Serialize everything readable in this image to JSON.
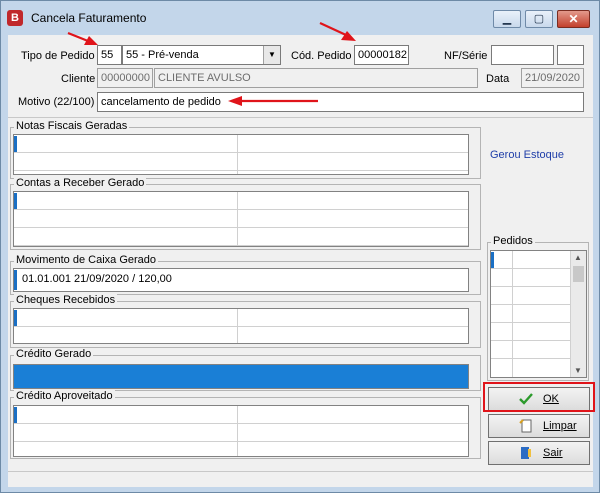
{
  "window": {
    "title": "Cancela Faturamento"
  },
  "header": {
    "tipo_pedido_label": "Tipo de Pedido",
    "tipo_pedido_code": "55",
    "tipo_pedido_value": "55 - Pré-venda",
    "cod_pedido_label": "Cód. Pedido",
    "cod_pedido_value": "00000182",
    "nf_serie_label": "NF/Série",
    "nf_value": "",
    "serie_value": "",
    "cliente_label": "Cliente",
    "cliente_code": "00000000",
    "cliente_name": "CLIENTE AVULSO",
    "data_label": "Data",
    "data_value": "21/09/2020",
    "motivo_label": "Motivo (22/100)",
    "motivo_value": "cancelamento de pedido"
  },
  "groups": {
    "notas": "Notas Fiscais Geradas",
    "contas": "Contas a Receber Gerado",
    "movimento": "Movimento de Caixa Gerado",
    "movimento_row": "01.01.001 21/09/2020 / 120,00",
    "cheques": "Cheques Recebidos",
    "credito_gerado": "Crédito Gerado",
    "credito_aproveitado": "Crédito Aproveitado"
  },
  "side": {
    "gerou_estoque": "Gerou Estoque",
    "pedidos": "Pedidos"
  },
  "buttons": {
    "ok": "OK",
    "limpar": "Limpar",
    "sair": "Sair"
  },
  "colors": {
    "accent": "#1a6fc4",
    "highlight": "#e0141a",
    "estoque_text": "#1f3ea8"
  }
}
